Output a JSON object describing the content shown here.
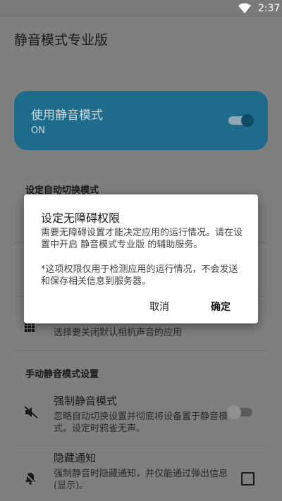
{
  "status_bar": {
    "time": "2:37"
  },
  "app_bar": {
    "title": "静音模式专业版"
  },
  "master_switch": {
    "label": "使用静音模式",
    "state": "ON"
  },
  "auto_section": {
    "title": "设定自动切换模式",
    "camera_subtitle": "选择要关闭默认相机声音的应用"
  },
  "manual_section": {
    "title": "手动静音模式设置",
    "force_silent": {
      "title": "强制静音模式",
      "subtitle": "忽略自动切换设置并彻底将设备置于静音模式。设定时鸦雀无声。"
    },
    "hide_notifications": {
      "title": "隐藏通知",
      "subtitle": "强制静音时隐藏通知，并仅能通过弹出信息(显示)。"
    }
  },
  "dialog": {
    "title": "设定无障碍权限",
    "message": "需要无障碍设置才能决定应用的运行情况。请在设置中开启 静音模式专业版 的辅助服务。",
    "note": "*这项权限仅用于检测应用的运行情况，不会发送和保存相关信息到服务器。",
    "cancel_label": "取消",
    "ok_label": "确定"
  },
  "colors": {
    "accent": "#2196d3",
    "scrim": "#7f7f7f"
  }
}
